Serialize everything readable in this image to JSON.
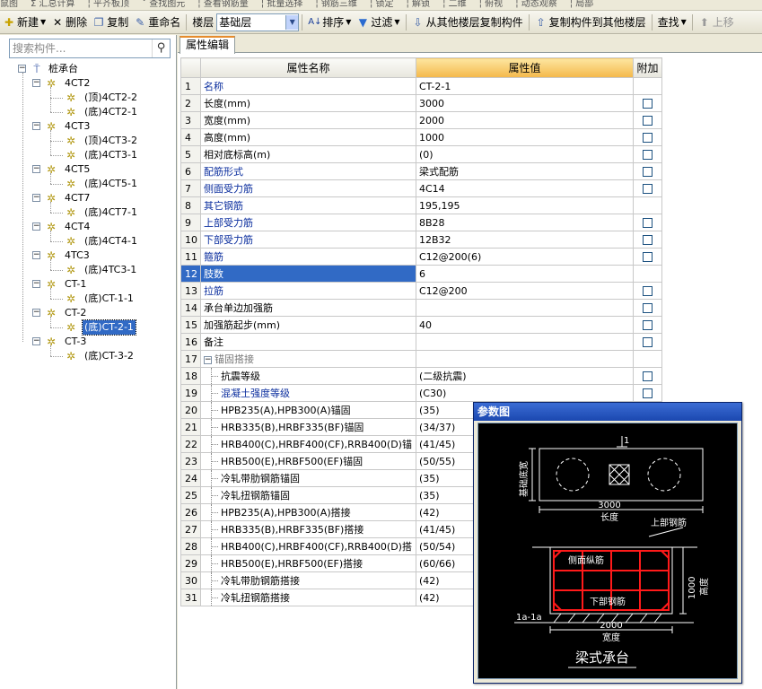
{
  "top_strip": [
    "鼠图",
    "Σ 汇总计算",
    "¦ 平齐板顶",
    "ˇ 查找图元",
    "¦ 查看钢筋量",
    "¦ 批量选择",
    "¦ 钢筋三维",
    "¦ 锁定",
    "¦ 解锁",
    "¦ 二维",
    "¦ 俯视",
    "¦ 动态观察",
    "¦ 局部"
  ],
  "toolbar": {
    "new_label": "新建",
    "delete_label": "删除",
    "copy_label": "复制",
    "rename_label": "重命名",
    "floor_label": "楼层",
    "floor_value": "基础层",
    "sort_label": "排序",
    "filter_label": "过滤",
    "copy_from_label": "从其他楼层复制构件",
    "copy_to_label": "复制构件到其他楼层",
    "find_label": "查找",
    "move_up_label": "上移"
  },
  "search": {
    "placeholder": "搜索构件..."
  },
  "tree": {
    "root": "桩承台",
    "groups": [
      {
        "name": "4CT2",
        "children": [
          "(顶)4CT2-2",
          "(底)4CT2-1"
        ]
      },
      {
        "name": "4CT3",
        "children": [
          "(顶)4CT3-2",
          "(底)4CT3-1"
        ]
      },
      {
        "name": "4CT5",
        "children": [
          "(底)4CT5-1"
        ]
      },
      {
        "name": "4CT7",
        "children": [
          "(底)4CT7-1"
        ]
      },
      {
        "name": "4CT4",
        "children": [
          "(底)4CT4-1"
        ]
      },
      {
        "name": "4TC3",
        "children": [
          "(底)4TC3-1"
        ]
      },
      {
        "name": "CT-1",
        "children": [
          "(底)CT-1-1"
        ]
      },
      {
        "name": "CT-2",
        "children": [
          "(底)CT-2-1"
        ]
      },
      {
        "name": "CT-3",
        "children": [
          "(底)CT-3-2"
        ]
      }
    ],
    "selected": "(底)CT-2-1"
  },
  "tab": {
    "label": "属性编辑"
  },
  "grid": {
    "headers": {
      "name": "属性名称",
      "value": "属性值",
      "extra": "附加"
    },
    "rows": [
      {
        "n": "1",
        "name": "名称",
        "value": "CT-2-1",
        "blue": true,
        "cb": false
      },
      {
        "n": "2",
        "name": "长度(mm)",
        "value": "3000",
        "cb": true
      },
      {
        "n": "3",
        "name": "宽度(mm)",
        "value": "2000",
        "cb": true
      },
      {
        "n": "4",
        "name": "高度(mm)",
        "value": "1000",
        "cb": true
      },
      {
        "n": "5",
        "name": "相对底标高(m)",
        "value": "(0)",
        "cb": true
      },
      {
        "n": "6",
        "name": "配筋形式",
        "value": "梁式配筋",
        "blue": true,
        "cb": true
      },
      {
        "n": "7",
        "name": "侧面受力筋",
        "value": "4C14",
        "blue": true,
        "cb": true
      },
      {
        "n": "8",
        "name": "其它钢筋",
        "value": "195,195",
        "blue": true,
        "cb": false
      },
      {
        "n": "9",
        "name": "上部受力筋",
        "value": "8B28",
        "blue": true,
        "cb": true
      },
      {
        "n": "10",
        "name": "下部受力筋",
        "value": "12B32",
        "blue": true,
        "cb": true
      },
      {
        "n": "11",
        "name": "箍筋",
        "value": "C12@200(6)",
        "blue": true,
        "cb": true
      },
      {
        "n": "12",
        "name": "肢数",
        "value": "6",
        "selected": true,
        "cb": false
      },
      {
        "n": "13",
        "name": "拉筋",
        "value": "C12@200",
        "blue": true,
        "cb": true
      },
      {
        "n": "14",
        "name": "承台单边加强筋",
        "value": "",
        "cb": true
      },
      {
        "n": "15",
        "name": "加强筋起步(mm)",
        "value": "40",
        "cb": true
      },
      {
        "n": "16",
        "name": "备注",
        "value": "",
        "cb": true
      },
      {
        "n": "17",
        "name": "锚固搭接",
        "value": "",
        "group": true,
        "cb": false
      },
      {
        "n": "18",
        "name": "抗震等级",
        "value": "(二级抗震)",
        "indent": true,
        "cb": true
      },
      {
        "n": "19",
        "name": "混凝土强度等级",
        "value": "(C30)",
        "indent": true,
        "blue": true,
        "cb": true
      },
      {
        "n": "20",
        "name": "HPB235(A),HPB300(A)锚固",
        "value": "(35)",
        "indent": true,
        "cb": false
      },
      {
        "n": "21",
        "name": "HRB335(B),HRBF335(BF)锚固",
        "value": "(34/37)",
        "indent": true,
        "cb": false
      },
      {
        "n": "22",
        "name": "HRB400(C),HRBF400(CF),RRB400(D)锚",
        "value": "(41/45)",
        "indent": true,
        "cb": false
      },
      {
        "n": "23",
        "name": "HRB500(E),HRBF500(EF)锚固",
        "value": "(50/55)",
        "indent": true,
        "cb": false
      },
      {
        "n": "24",
        "name": "冷轧带肋钢筋锚固",
        "value": "(35)",
        "indent": true,
        "cb": false
      },
      {
        "n": "25",
        "name": "冷轧扭钢筋锚固",
        "value": "(35)",
        "indent": true,
        "cb": false
      },
      {
        "n": "26",
        "name": "HPB235(A),HPB300(A)搭接",
        "value": "(42)",
        "indent": true,
        "cb": false
      },
      {
        "n": "27",
        "name": "HRB335(B),HRBF335(BF)搭接",
        "value": "(41/45)",
        "indent": true,
        "cb": false
      },
      {
        "n": "28",
        "name": "HRB400(C),HRBF400(CF),RRB400(D)搭",
        "value": "(50/54)",
        "indent": true,
        "cb": false
      },
      {
        "n": "29",
        "name": "HRB500(E),HRBF500(EF)搭接",
        "value": "(60/66)",
        "indent": true,
        "cb": false
      },
      {
        "n": "30",
        "name": "冷轧带肋钢筋搭接",
        "value": "(42)",
        "indent": true,
        "cb": false
      },
      {
        "n": "31",
        "name": "冷轧扭钢筋搭接",
        "value": "(42)",
        "indent": true,
        "cb": false
      }
    ]
  },
  "popup": {
    "title": "参数图",
    "section_mark": "1",
    "left_dim_label": "基础底宽",
    "length_value": "3000",
    "length_label": "长度",
    "top_bar_label": "上部钢筋",
    "side_bar_label": "侧面纵筋",
    "bottom_bar_label": "下部钢筋",
    "height_value": "1000",
    "height_label": "高度",
    "section_label": "1a-1a",
    "width_value": "2000",
    "width_label": "宽度",
    "caption": "梁式承台",
    "colors": {
      "background": "#000000",
      "lines": "#ffffff",
      "rebar": "#ff1a1a"
    }
  }
}
